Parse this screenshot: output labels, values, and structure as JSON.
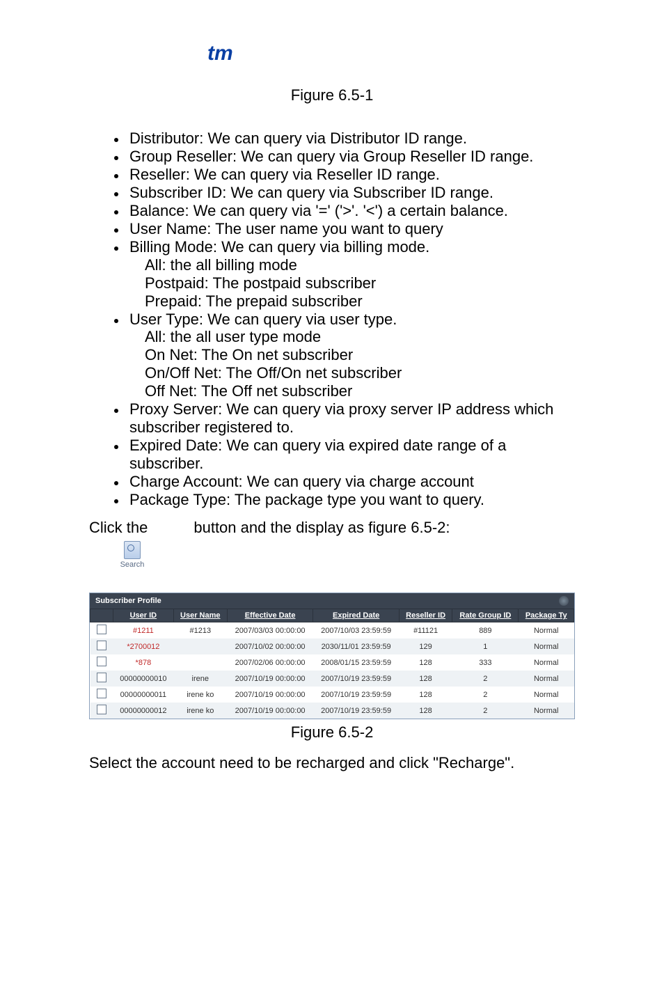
{
  "logo_text": "tm",
  "figure_label_1": "Figure 6.5-1",
  "figure_label_2": "Figure 6.5-2",
  "bullets": {
    "distributor": "Distributor: We can query via Distributor ID range.",
    "group_reseller": "Group Reseller: We can query via Group Reseller ID range.",
    "reseller": "Reseller: We can query via Reseller ID range.",
    "subscriber_id": "Subscriber ID: We can query via Subscriber ID range.",
    "balance": "Balance: We can query via '=' ('>'. '<') a certain balance.",
    "user_name": "User Name: The user name you want to query",
    "billing_mode": "Billing Mode: We can query via billing mode.",
    "billing_sub": {
      "all": "All: the all billing mode",
      "postpaid": "Postpaid: The postpaid subscriber",
      "prepaid": "Prepaid: The prepaid subscriber"
    },
    "user_type": "User Type: We can query via user type.",
    "user_type_sub": {
      "all": "All: the all user type mode",
      "on": "On Net: The On net subscriber",
      "onoff": "On/Off Net: The Off/On net subscriber",
      "off": "Off Net: The Off net subscriber"
    },
    "proxy": "Proxy Server: We can query via proxy server IP address which subscriber registered to.",
    "expired": "Expired Date: We can query via expired date range of a subscriber.",
    "charge": "Charge Account: We can query via charge account",
    "package": "Package Type: The package type you want to query."
  },
  "click_line_prefix": "Click the",
  "click_line_suffix": "button and the display as figure 6.5-2:",
  "search_btn_label": "Search",
  "profile_title": "Subscriber Profile",
  "headers": {
    "user_id": "User ID",
    "user_name": "User Name",
    "effective": "Effective Date",
    "expired": "Expired Date",
    "reseller": "Reseller ID",
    "rate_group": "Rate Group ID",
    "package": "Package Ty"
  },
  "rows": [
    {
      "uid": "#1211",
      "uid_red": true,
      "name": "#1213",
      "eff": "2007/03/03 00:00:00",
      "exp": "2007/10/03 23:59:59",
      "res": "#11121",
      "rg": "889",
      "pt": "Normal"
    },
    {
      "uid": "*2700012",
      "uid_red": true,
      "name": "",
      "eff": "2007/10/02 00:00:00",
      "exp": "2030/11/01 23:59:59",
      "res": "129",
      "rg": "1",
      "pt": "Normal"
    },
    {
      "uid": "*878",
      "uid_red": true,
      "name": "",
      "eff": "2007/02/06 00:00:00",
      "exp": "2008/01/15 23:59:59",
      "res": "128",
      "rg": "333",
      "pt": "Normal"
    },
    {
      "uid": "00000000010",
      "uid_red": false,
      "name": "irene",
      "eff": "2007/10/19 00:00:00",
      "exp": "2007/10/19 23:59:59",
      "res": "128",
      "rg": "2",
      "pt": "Normal"
    },
    {
      "uid": "00000000011",
      "uid_red": false,
      "name": "irene ko",
      "eff": "2007/10/19 00:00:00",
      "exp": "2007/10/19 23:59:59",
      "res": "128",
      "rg": "2",
      "pt": "Normal"
    },
    {
      "uid": "00000000012",
      "uid_red": false,
      "name": "irene ko",
      "eff": "2007/10/19 00:00:00",
      "exp": "2007/10/19 23:59:59",
      "res": "128",
      "rg": "2",
      "pt": "Normal"
    }
  ],
  "final_para": "Select the account need to be recharged and click \"Recharge\"."
}
